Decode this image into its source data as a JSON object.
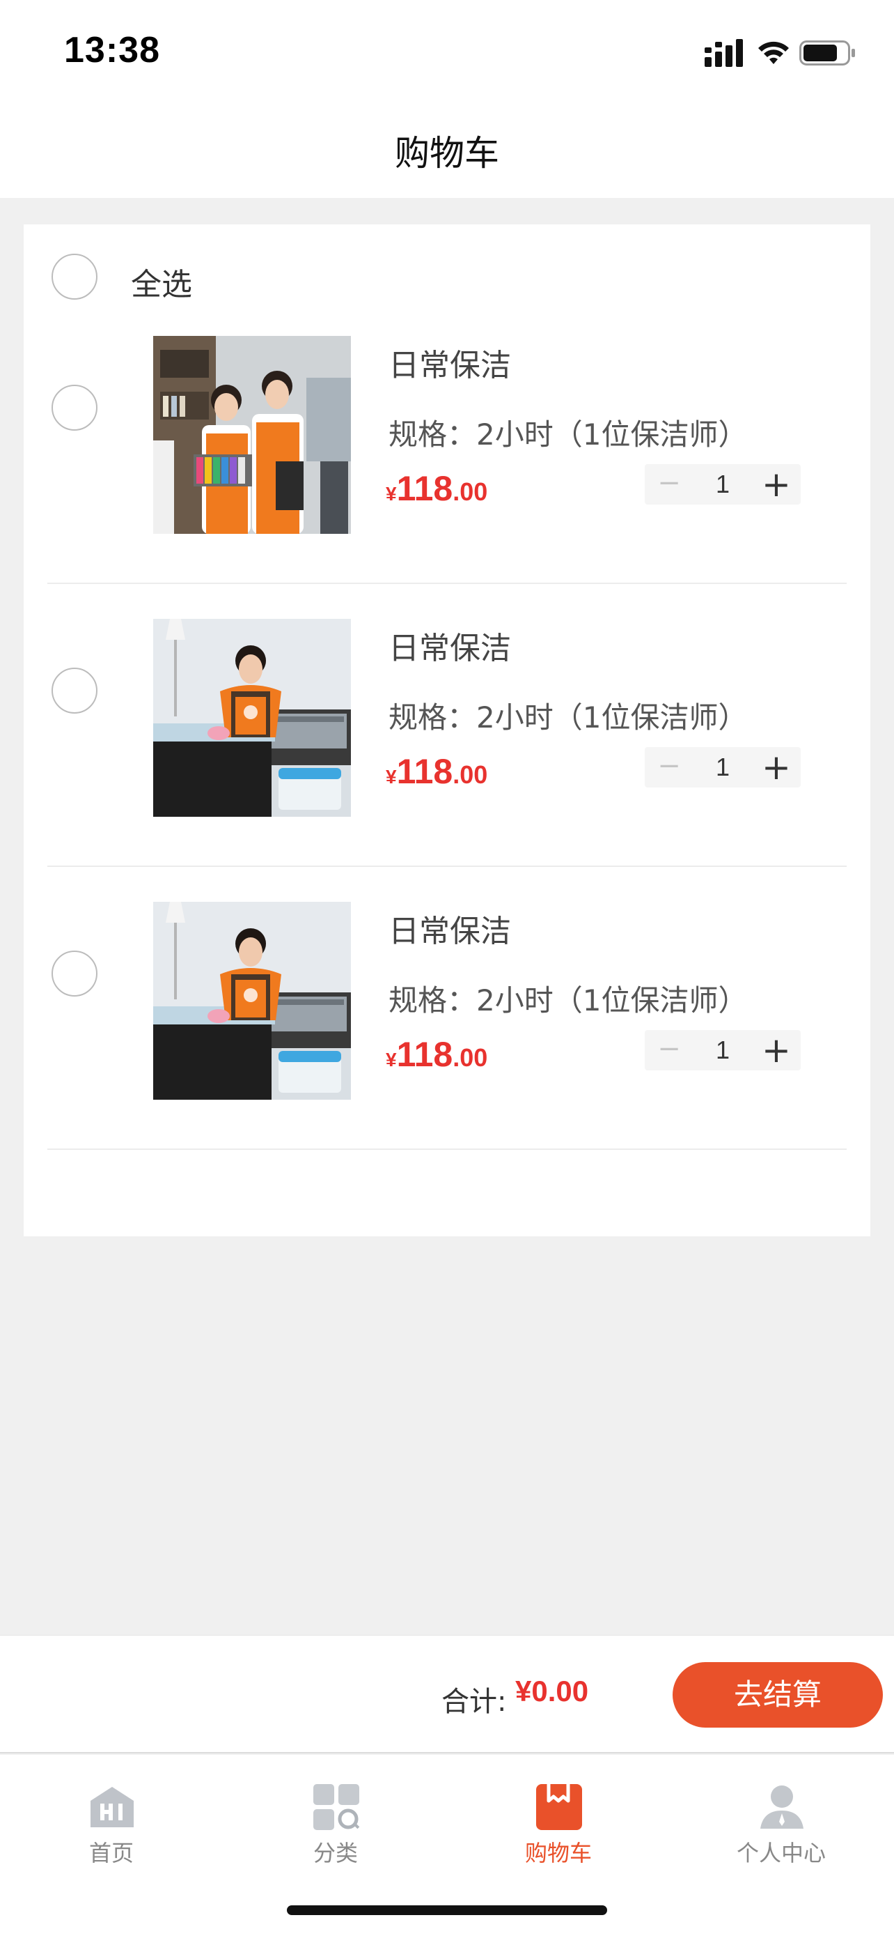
{
  "status_bar": {
    "time": "13:38",
    "icons": [
      "signal-icon",
      "wifi-icon",
      "battery-icon"
    ]
  },
  "nav": {
    "title": "购物车"
  },
  "cart": {
    "select_all_label": "全选",
    "items": [
      {
        "name": "日常保洁",
        "spec": "规格：2小时（1位保洁师）",
        "price_symbol": "¥",
        "price_integer": "118",
        "price_decimal": ".00",
        "quantity": "1",
        "minus_label": "−",
        "plus_label": "+",
        "checked": false,
        "image": "two-cleaners-photo"
      },
      {
        "name": "日常保洁",
        "spec": "规格：2小时（1位保洁师）",
        "price_symbol": "¥",
        "price_integer": "118",
        "price_decimal": ".00",
        "quantity": "1",
        "minus_label": "−",
        "plus_label": "+",
        "checked": false,
        "image": "cleaner-wiping-table-photo"
      },
      {
        "name": "日常保洁",
        "spec": "规格：2小时（1位保洁师）",
        "price_symbol": "¥",
        "price_integer": "118",
        "price_decimal": ".00",
        "quantity": "1",
        "minus_label": "−",
        "plus_label": "+",
        "checked": false,
        "image": "cleaner-wiping-table-photo"
      }
    ]
  },
  "checkout": {
    "total_label": "合计:",
    "total_value": "¥0.00",
    "button_label": "去结算"
  },
  "tabs": [
    {
      "label": "首页",
      "icon": "home-icon",
      "active": false
    },
    {
      "label": "分类",
      "icon": "category-icon",
      "active": false
    },
    {
      "label": "购物车",
      "icon": "cart-icon",
      "active": true
    },
    {
      "label": "个人中心",
      "icon": "profile-icon",
      "active": false
    }
  ],
  "colors": {
    "accent": "#e9512a",
    "price": "#e8322e",
    "background": "#f0f0f0"
  }
}
